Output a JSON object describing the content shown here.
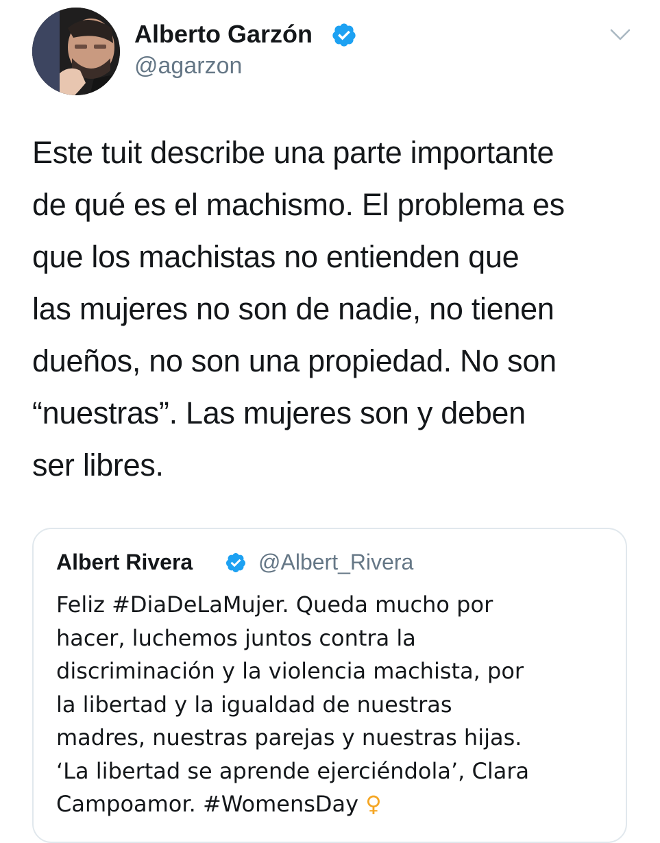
{
  "tweet": {
    "author": {
      "name": "Alberto Garzón",
      "handle": "@agarzon",
      "verified": true
    },
    "text": "Este tuit describe una parte importante\nde qué es el machismo. El problema es\nque los machistas no entienden que\nlas mujeres no son de nadie, no tienen\ndueños, no son una propiedad. No son\n“nuestras”. Las mujeres son y deben\nser libres."
  },
  "quoted_tweet": {
    "author": {
      "name": "Albert Rivera",
      "handle": "@Albert_Rivera",
      "verified": true
    },
    "text": "Feliz #DiaDeLaMujer. Queda mucho por\nhacer, luchemos juntos contra la\ndiscriminación y la violencia machista, por\nla libertad y la igualdad de nuestras\nmadres, nuestras parejas y nuestras hijas.\n‘La libertad se aprende ejerciéndola’, Clara\nCampoamor. #WomensDay",
    "emoji": "♀"
  },
  "icons": {
    "verified": "verified-badge-icon",
    "menu": "chevron-down-icon",
    "emoji": "female-sign-emoji"
  },
  "colors": {
    "verified_blue": "#1da1f2",
    "secondary_text": "#657786",
    "primary_text": "#14171a",
    "card_border": "#e1e8ed",
    "emoji_orange": "#f5a623"
  }
}
